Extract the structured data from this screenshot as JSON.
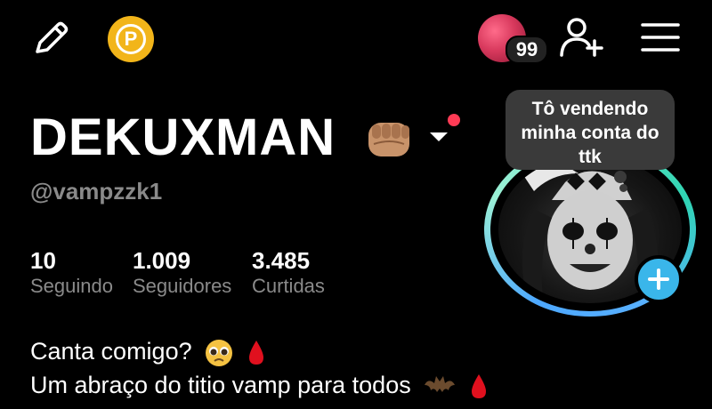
{
  "header": {
    "edit_icon": "pencil-icon",
    "coin_icon": "coin-p-icon",
    "coin_letter": "P",
    "notification_count": "99",
    "add_user_icon": "add-user-icon",
    "menu_icon": "hamburger-icon"
  },
  "profile": {
    "display_name": "DEKUXMAN",
    "name_emoji": "fist-bump-icon",
    "handle": "@vampzzk1",
    "stats": [
      {
        "value": "10",
        "label": "Seguindo"
      },
      {
        "value": "1.009",
        "label": "Seguidores"
      },
      {
        "value": "3.485",
        "label": "Curtidas"
      }
    ],
    "bio_lines": [
      {
        "text": "Canta comigo?",
        "emojis": [
          "pleading-face-icon",
          "blood-drop-icon"
        ]
      },
      {
        "text": "Um abraço do titio vamp para todos",
        "emojis": [
          "bat-icon",
          "blood-drop-icon"
        ]
      }
    ],
    "status_bubble": {
      "lines": [
        "Tô vendendo",
        "minha conta do",
        "ttk"
      ]
    }
  },
  "colors": {
    "background": "#000000",
    "secondary_text": "#8a8a8a",
    "coin": "#f2b51a",
    "plus_button": "#3ab6ea",
    "notification_dot": "#ff3b55",
    "ring_start": "#6fe8c6",
    "ring_end": "#4da8ff",
    "bubble": "#3a3a3a"
  }
}
